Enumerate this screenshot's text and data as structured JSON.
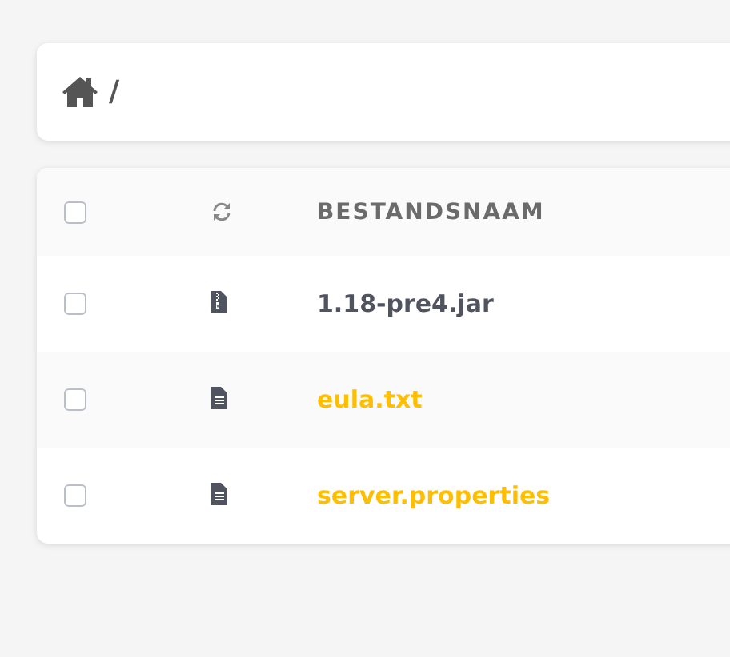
{
  "breadcrumb": {
    "separator": "/"
  },
  "table": {
    "header": {
      "checked": false,
      "column": "BESTANDSNAAM"
    },
    "rows": [
      {
        "kind": "archive",
        "name": "1.18-pre4.jar",
        "checked": false,
        "color": "#50545e"
      },
      {
        "kind": "text",
        "name": "eula.txt",
        "checked": false,
        "color": "#ffbf00"
      },
      {
        "kind": "text",
        "name": "server.properties",
        "checked": false,
        "color": "#ffbf00"
      }
    ]
  }
}
